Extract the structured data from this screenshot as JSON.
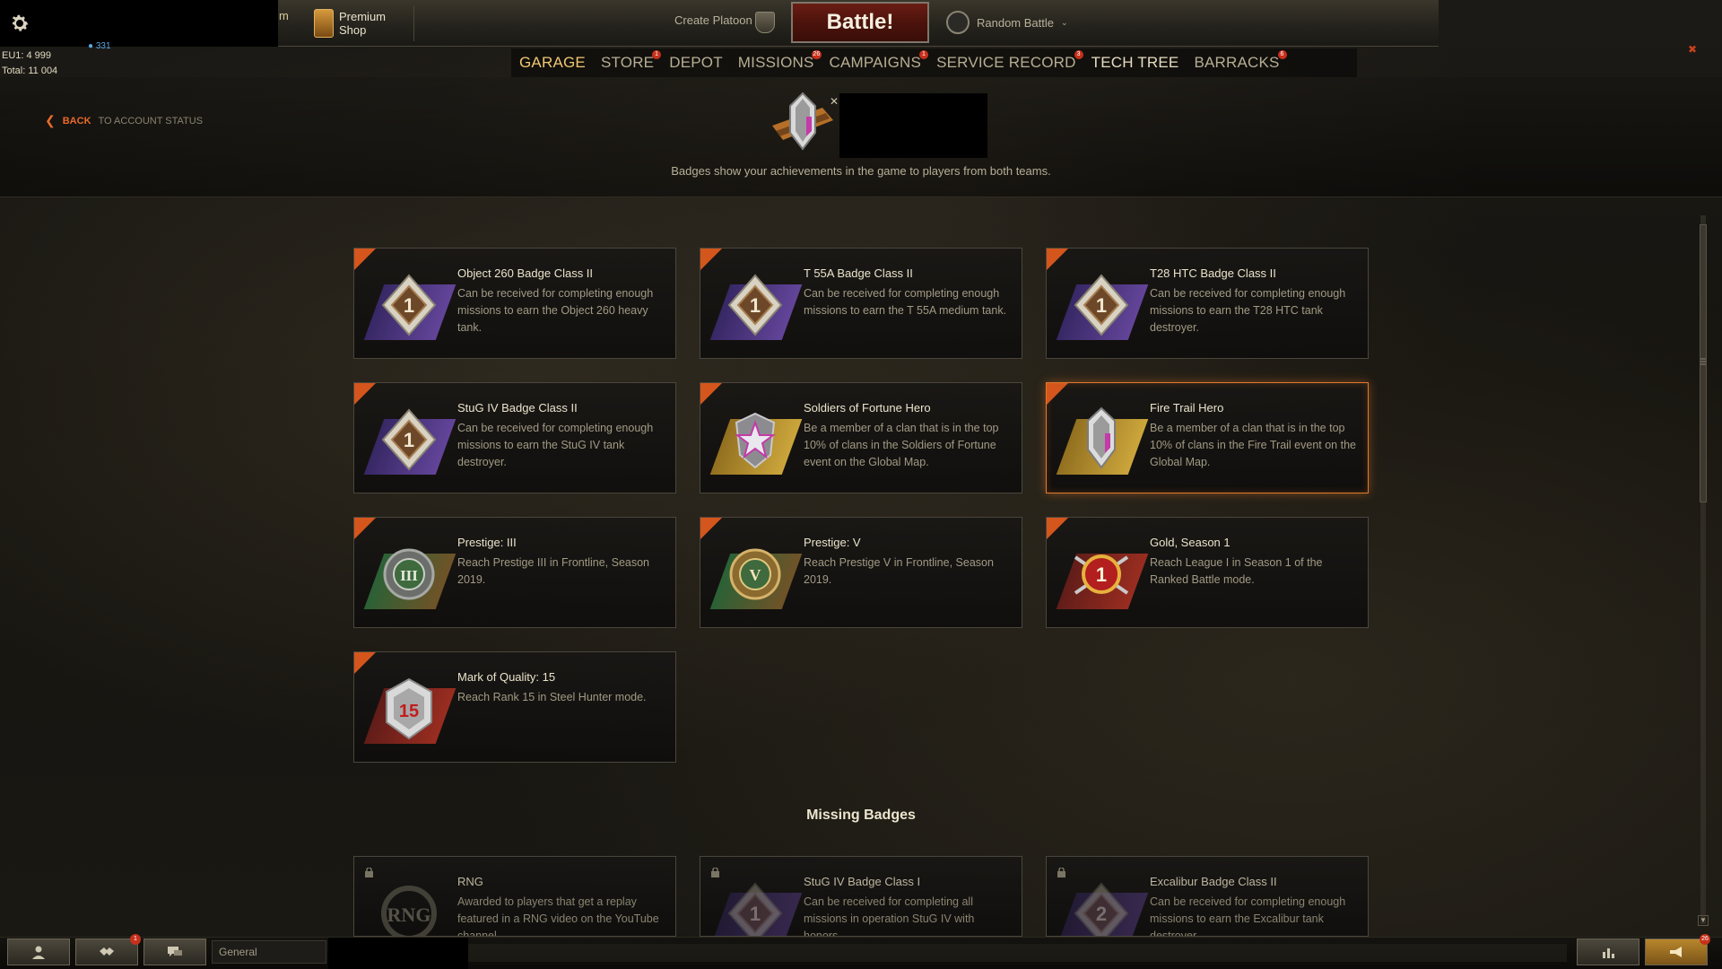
{
  "header": {
    "partial_tab": "m",
    "premium_shop": {
      "line1": "Premium",
      "line2": "Shop",
      "icon": "shopping-bag-icon"
    },
    "create_platoon": "Create Platoon",
    "battle": "Battle!",
    "battle_mode": "Random Battle",
    "stats": {
      "eu": "EU1: 4 999",
      "total": "Total: 11 004"
    },
    "blue_counter": "331"
  },
  "nav": [
    {
      "label": "GARAGE",
      "badge": ""
    },
    {
      "label": "STORE",
      "badge": "1"
    },
    {
      "label": "DEPOT",
      "badge": ""
    },
    {
      "label": "MISSIONS",
      "badge": "26"
    },
    {
      "label": "CAMPAIGNS",
      "badge": "1"
    },
    {
      "label": "SERVICE RECORD",
      "badge": "3"
    },
    {
      "label": "TECH TREE",
      "badge": ""
    },
    {
      "label": "BARRACKS",
      "badge": "6"
    }
  ],
  "back": {
    "label": "BACK",
    "sub": "TO ACCOUNT STATUS"
  },
  "header_badge": {
    "caption": "Badges show your achievements in the game to players from both teams."
  },
  "badges": [
    {
      "title": "Object 260 Badge Class II",
      "desc": "Can be received for completing enough missions to earn the Object 260 heavy tank.",
      "icon": "class-1-badge-icon",
      "glyph": "1"
    },
    {
      "title": "T 55A Badge Class II",
      "desc": "Can be received for completing enough missions to earn the T 55A medium tank.",
      "icon": "class-1-badge-icon",
      "glyph": "1"
    },
    {
      "title": "T28 HTC Badge Class II",
      "desc": "Can be received for completing enough missions to earn the T28 HTC tank destroyer.",
      "icon": "class-1-badge-icon",
      "glyph": "1"
    },
    {
      "title": "StuG IV Badge Class II",
      "desc": "Can be received for completing enough missions to earn the StuG IV tank destroyer.",
      "icon": "class-1-badge-icon",
      "glyph": "1"
    },
    {
      "title": "Soldiers of Fortune Hero",
      "desc": "Be a member of a clan that is in the top 10% of clans in the Soldiers of Fortune event on the Global Map.",
      "icon": "star-shield-icon",
      "glyph": ""
    },
    {
      "title": "Fire Trail Hero",
      "desc": "Be a member of a clan that is in the top 10% of clans in the Fire Trail event on the Global Map.",
      "icon": "shield-crest-icon",
      "glyph": ""
    },
    {
      "title": "Prestige: III",
      "desc": "Reach Prestige III in Frontline, Season 2019.",
      "icon": "prestige-wreath-icon",
      "glyph": "III"
    },
    {
      "title": "Prestige: V",
      "desc": "Reach Prestige V in Frontline, Season 2019.",
      "icon": "prestige-wreath-icon",
      "glyph": "V"
    },
    {
      "title": "Gold, Season 1",
      "desc": "Reach League I in Season 1 of the Ranked Battle mode.",
      "icon": "gold-league-icon",
      "glyph": "1"
    },
    {
      "title": "Mark of Quality: 15",
      "desc": "Reach Rank 15 in Steel Hunter mode.",
      "icon": "mark-of-quality-icon",
      "glyph": "15"
    }
  ],
  "missing_title": "Missing Badges",
  "missing_badges": [
    {
      "title": "RNG",
      "desc": "Awarded to players that get a replay featured in a RNG video on the YouTube channel.",
      "icon": "rng-wreath-icon",
      "glyph": "RNG"
    },
    {
      "title": "StuG IV Badge Class I",
      "desc": "Can be received for completing all missions in operation StuG IV with honors.",
      "icon": "class-1-badge-icon",
      "glyph": "1"
    },
    {
      "title": "Excalibur Badge Class II",
      "desc": "Can be received for completing enough missions to earn the Excalibur tank destroyer.",
      "icon": "class-2-badge-icon",
      "glyph": "2"
    }
  ],
  "bottom": {
    "chat_channel": "General",
    "friends_badge": "1",
    "notif_badge": "26"
  },
  "colors": {
    "accent": "#e76a2c",
    "battle": "#5a160e",
    "nav_active": "#f0c772"
  }
}
